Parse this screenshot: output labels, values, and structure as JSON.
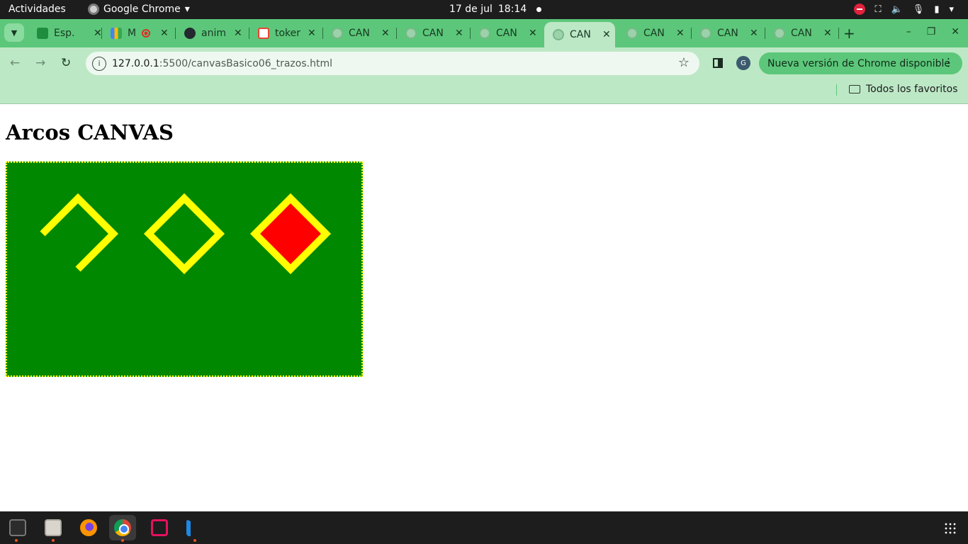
{
  "topbar": {
    "activities": "Actividades",
    "app_name": "Google Chrome",
    "date": "17 de jul",
    "time": "18:14"
  },
  "tabs": [
    {
      "title": "Esp.",
      "favicon": "contacts-icon"
    },
    {
      "title": "M",
      "favicon": "meet-icon"
    },
    {
      "title": "anim",
      "favicon": "github-icon"
    },
    {
      "title": "toker",
      "favicon": "gmail-icon"
    },
    {
      "title": "CAN",
      "favicon": "globe-icon"
    },
    {
      "title": "CAN",
      "favicon": "globe-icon"
    },
    {
      "title": "CAN",
      "favicon": "globe-icon"
    },
    {
      "title": "CAN",
      "favicon": "globe-icon",
      "active": true
    },
    {
      "title": "CAN",
      "favicon": "globe-icon"
    },
    {
      "title": "CAN",
      "favicon": "globe-icon"
    },
    {
      "title": "CAN",
      "favicon": "globe-icon"
    }
  ],
  "omnibox": {
    "host": "127.0.0.1",
    "path": ":5500/canvasBasico06_trazos.html"
  },
  "profile_initial": "G",
  "update_button": "Nueva versión de Chrome disponible",
  "bookmarks": {
    "all": "Todos los favoritos"
  },
  "page": {
    "heading": "Arcos CANVAS"
  },
  "canvas": {
    "background": "#008800",
    "stroke": "#ffff00",
    "fill": "#ff0000"
  },
  "dock": [
    "terminal-icon",
    "files-icon",
    "firefox-icon",
    "chrome-icon",
    "screenshot-icon",
    "vscode-icon"
  ]
}
